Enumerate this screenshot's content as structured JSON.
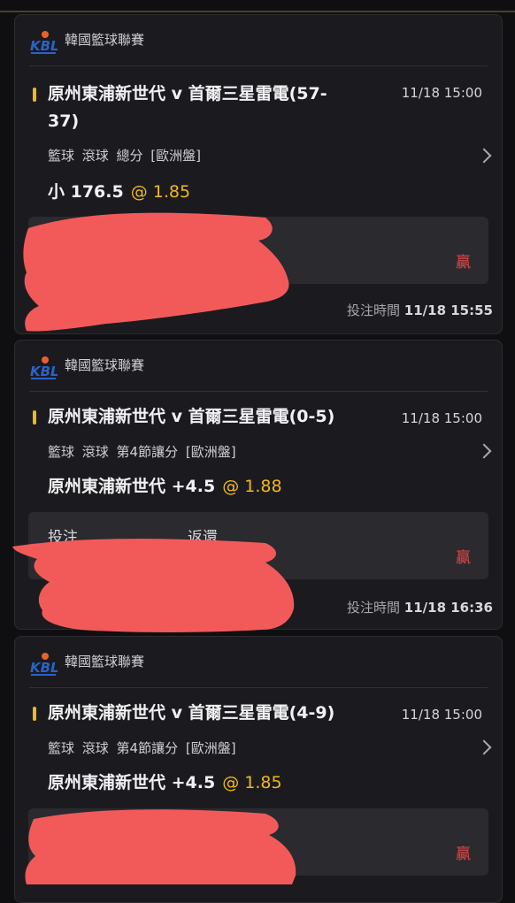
{
  "colors": {
    "accent": "#f0b81e",
    "win": "#e24848",
    "redaction": "#f25a5a"
  },
  "bets": [
    {
      "league": "韓國籃球聯賽",
      "logo_icon": "kbl-logo-icon",
      "match": "原州東浦新世代 v 首爾三星雷電(57-37)",
      "time": "11/18 15:00",
      "market": "籃球 滾球  總分 [歐洲盤]",
      "selection": "小 176.5",
      "odds": "@ 1.85",
      "labels": [],
      "result": "贏",
      "bet_time_label": "投注時間",
      "bet_time_value": "11/18 15:55"
    },
    {
      "league": "韓國籃球聯賽",
      "logo_icon": "kbl-logo-icon",
      "match": "原州東浦新世代 v 首爾三星雷電(0-5)",
      "time": "11/18 15:00",
      "market": "籃球 滾球  第4節讓分 [歐洲盤]",
      "selection": "原州東浦新世代 +4.5",
      "odds": "@ 1.88",
      "labels": [
        "投注",
        "返還"
      ],
      "result": "贏",
      "bet_time_label": "投注時間",
      "bet_time_value": "11/18 16:36"
    },
    {
      "league": "韓國籃球聯賽",
      "logo_icon": "kbl-logo-icon",
      "match": "原州東浦新世代 v 首爾三星雷電(4-9)",
      "time": "11/18 15:00",
      "market": "籃球 滾球  第4節讓分 [歐洲盤]",
      "selection": "原州東浦新世代 +4.5",
      "odds": "@ 1.85",
      "labels": [],
      "result": "贏"
    }
  ]
}
